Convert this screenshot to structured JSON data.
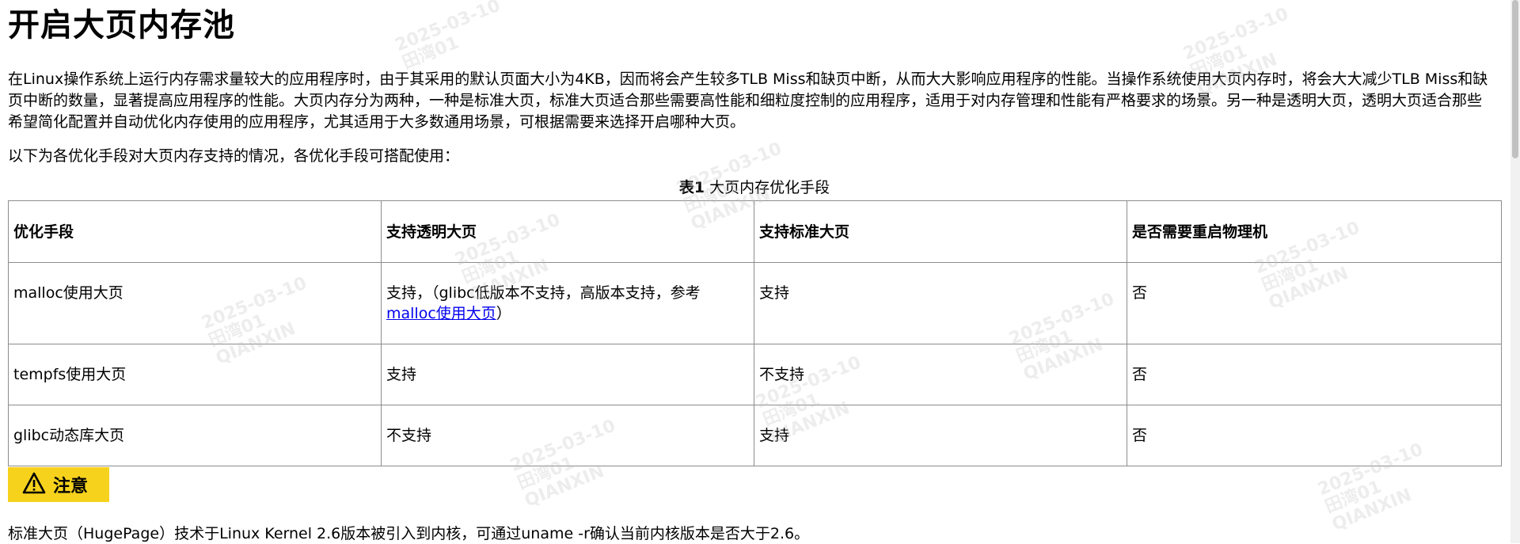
{
  "title": "开启大页内存池",
  "intro": "在Linux操作系统上运行内存需求量较大的应用程序时，由于其采用的默认页面大小为4KB，因而将会产生较多TLB Miss和缺页中断，从而大大影响应用程序的性能。当操作系统使用大页内存时，将会大大减少TLB Miss和缺页中断的数量，显著提高应用程序的性能。大页内存分为两种，一种是标准大页，标准大页适合那些需要高性能和细粒度控制的应用程序，适用于对内存管理和性能有严格要求的场景。另一种是透明大页，透明大页适合那些希望简化配置并自动优化内存使用的应用程序，尤其适用于大多数通用场景，可根据需要来选择开启哪种大页。",
  "lead": "以下为各优化手段对大页内存支持的情况，各优化手段可搭配使用：",
  "caption": {
    "label": "表1",
    "text": " 大页内存优化手段"
  },
  "table": {
    "headers": [
      "优化手段",
      "支持透明大页",
      "支持标准大页",
      "是否需要重启物理机"
    ],
    "rows": [
      {
        "method": "malloc使用大页",
        "thp_prefix": "支持，（glibc低版本不支持，高版本支持，参考",
        "thp_link": "malloc使用大页",
        "thp_suffix": "）",
        "standard": "支持",
        "reboot": "否"
      },
      {
        "method": "tempfs使用大页",
        "thp": "支持",
        "standard": "不支持",
        "reboot": "否"
      },
      {
        "method": "glibc动态库大页",
        "thp": "不支持",
        "standard": "支持",
        "reboot": "否"
      }
    ]
  },
  "notice": {
    "label": "注意",
    "icon": "warning-icon"
  },
  "note": "标准大页（HugePage）技术于Linux Kernel 2.6版本被引入到内核，可通过uname -r确认当前内核版本是否大于2.6。",
  "watermark": {
    "date": "2025-03-10",
    "user": "田湾01",
    "org": "QIANXIN"
  }
}
